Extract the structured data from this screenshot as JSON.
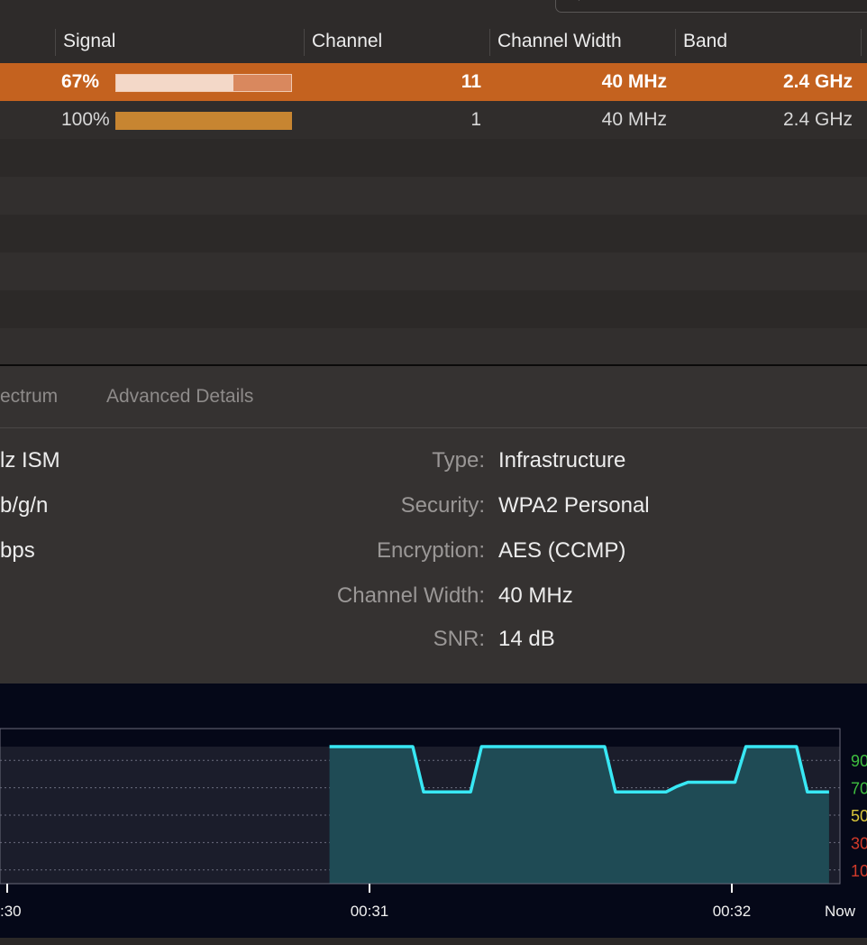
{
  "table": {
    "headers": {
      "signal": "Signal",
      "channel": "Channel",
      "channel_width": "Channel Width",
      "band": "Band"
    },
    "rows": [
      {
        "signal": "67%",
        "signal_level": 0.67,
        "channel": "11",
        "channel_width": "40 MHz",
        "band": "2.4 GHz",
        "selected": true
      },
      {
        "signal": "100%",
        "signal_level": 1.0,
        "channel": "1",
        "channel_width": "40 MHz",
        "band": "2.4 GHz",
        "selected": false
      }
    ]
  },
  "tabs": {
    "spectrum": "ectrum",
    "advanced": "Advanced Details"
  },
  "details": {
    "left": {
      "l1": "lz ISM",
      "l2": "b/g/n",
      "l3": "bps"
    },
    "right": [
      {
        "key": "Type:",
        "value": "Infrastructure"
      },
      {
        "key": "Security:",
        "value": "WPA2 Personal"
      },
      {
        "key": "Encryption:",
        "value": "AES (CCMP)"
      },
      {
        "key": "Channel Width:",
        "value": "40 MHz"
      },
      {
        "key": "SNR:",
        "value": "14 dB"
      }
    ]
  },
  "chart_data": {
    "type": "area",
    "x_ticks": [
      ":30",
      "00:31",
      "00:32",
      "Now"
    ],
    "y_ticks": [
      "90",
      "70",
      "50",
      "30",
      "10"
    ],
    "y_tick_colors": [
      "#3fbf3f",
      "#3fbf3f",
      "#d9c53a",
      "#d23a2a",
      "#d23a2a"
    ],
    "line_color": "#38e8f4",
    "fill_color": "#1f4b55",
    "ylim": [
      0,
      100
    ],
    "x_range_seconds": [
      0,
      129
    ],
    "series": [
      {
        "x": [
          91,
          114,
          117,
          130,
          133,
          167,
          170,
          184,
          187,
          190,
          203,
          206,
          220,
          223,
          229
        ],
        "values": [
          100,
          100,
          67,
          67,
          100,
          100,
          67,
          67,
          71,
          74,
          74,
          100,
          100,
          67,
          67
        ]
      }
    ]
  },
  "colors": {
    "selection": "#c4621f",
    "signal_bar": "#c78531"
  }
}
